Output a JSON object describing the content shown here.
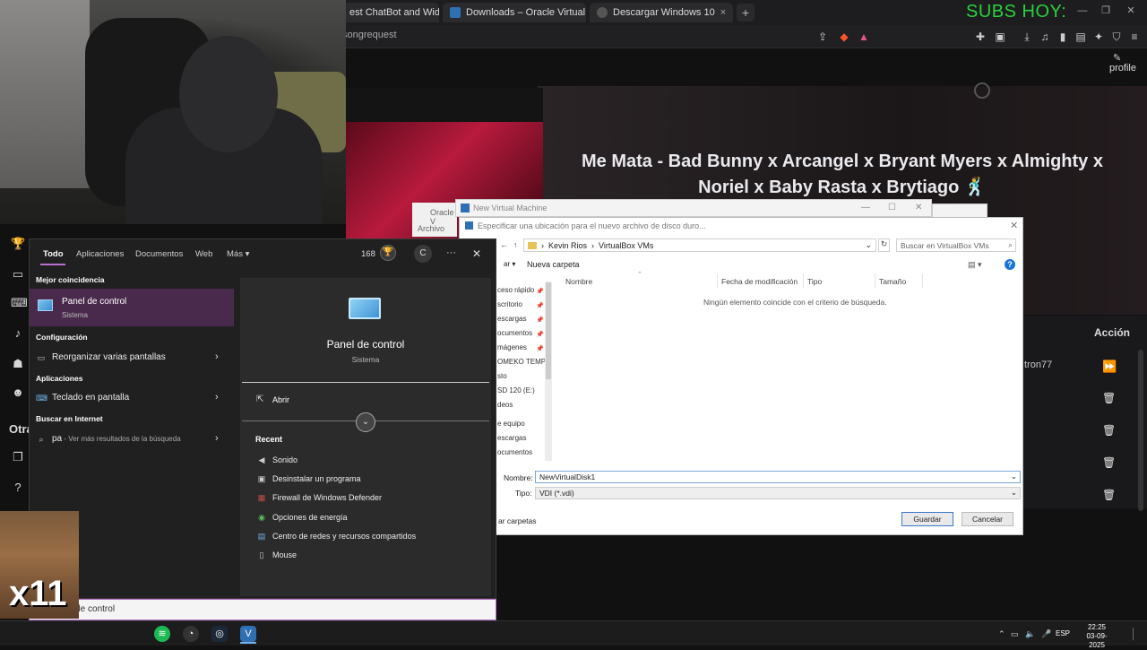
{
  "browser": {
    "tabs": [
      {
        "label": "est ChatBot and Widget",
        "x": "×"
      },
      {
        "label": "Downloads – Oracle VirtualBox",
        "x": "×"
      },
      {
        "label": "Descargar Windows 10",
        "x": "×"
      }
    ],
    "add_tab": "+",
    "overlay_subs": "SUBS HOY:",
    "url": "songrequest",
    "window_controls": [
      "—",
      "❐",
      "✕"
    ]
  },
  "page": {
    "song_title": "Me Mata - Bad Bunny x Arcangel x Bryant Myers x Almighty x Noriel x Baby Rasta x Brytiago 🕺",
    "profile_label": "profile",
    "queue_header": "Acción",
    "queue_user": "tron77"
  },
  "left_sidebar": {
    "otras_label": "Otra"
  },
  "virtualbox": {
    "oracle_title": "Oracle V",
    "oracle_menu": "Archivo",
    "nvm_title": "New Virtual Machine",
    "dialog_title": "Especificar una ubicación para el nuevo archivo de disco duro...",
    "path": [
      "Kevin Rios",
      "VirtualBox VMs"
    ],
    "search_placeholder": "Buscar en VirtualBox VMs",
    "organize": "ar ▾",
    "new_folder": "Nueva carpeta",
    "nav_items": [
      "ceso rápido",
      "scritorio",
      "escargas",
      "ocumentos",
      "mágenes",
      "OMEKO TEMPL",
      "sto",
      "SD 120 (E:)",
      "deos",
      "e equipo",
      "escargas",
      "ocumentos"
    ],
    "columns": [
      "Nombre",
      "Fecha de modificación",
      "Tipo",
      "Tamaño"
    ],
    "empty_message": "Ningún elemento coincide con el criterio de búsqueda.",
    "name_label": "Nombre:",
    "name_value": "NewVirtualDisk1",
    "type_label": "Tipo:",
    "type_value": "VDI (*.vdi)",
    "hide_folders": "ar carpetas",
    "save": "Guardar",
    "cancel": "Cancelar"
  },
  "search_panel": {
    "tabs": [
      "Todo",
      "Aplicaciones",
      "Documentos",
      "Web",
      "Más ▾"
    ],
    "points": "168",
    "user_initial": "C",
    "more": "···",
    "close": "✕",
    "best_match_header": "Mejor coincidencia",
    "best_match": {
      "name": "Panel de control",
      "sub": "Sistema"
    },
    "config_header": "Configuración",
    "config_item": "Reorganizar varias pantallas",
    "apps_header": "Aplicaciones",
    "apps_item": "Teclado en pantalla",
    "web_header": "Buscar en Internet",
    "web_query": "pa",
    "web_query_sub": " - Ver más resultados de la búsqueda",
    "preview": {
      "title": "Panel de control",
      "sub": "Sistema",
      "open": "Abrir",
      "recent_header": "Recent",
      "recent": [
        "Sonido",
        "Desinstalar un programa",
        "Firewall de Windows Defender",
        "Opciones de energía",
        "Centro de redes y recursos compartidos",
        "Mouse"
      ]
    },
    "query_text": "nel de control"
  },
  "meme": {
    "label": "x11"
  },
  "taskbar": {
    "time": "22:25",
    "date": "03-09-2025",
    "lang": "ESP"
  },
  "colors": {
    "accent_purple": "#b870d0",
    "subs_green": "#2ad13a",
    "dialog_blue": "#1a73d8"
  }
}
